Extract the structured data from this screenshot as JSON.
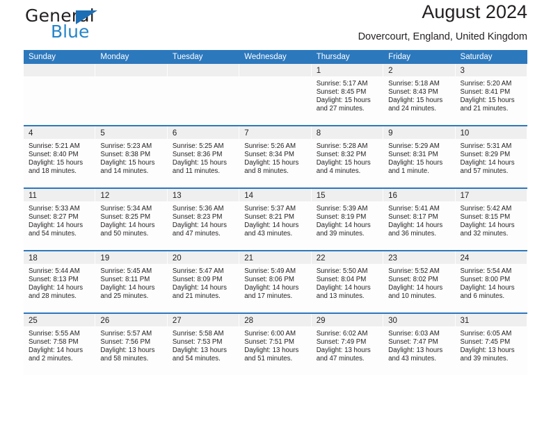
{
  "brand": {
    "name_part1": "General",
    "name_part2": "Blue",
    "triangle_color": "#1c6fb5",
    "blue_text_color": "#2585c9"
  },
  "header": {
    "title": "August 2024",
    "location": "Dovercourt, England, United Kingdom"
  },
  "theme": {
    "header_bar_color": "#2c78bd",
    "daynum_band_color": "#efefef",
    "row_divider_color": "#2c78bd",
    "text_color": "#231f20"
  },
  "weekdays": [
    "Sunday",
    "Monday",
    "Tuesday",
    "Wednesday",
    "Thursday",
    "Friday",
    "Saturday"
  ],
  "weeks": [
    [
      {
        "day": "",
        "sunrise": "",
        "sunset": "",
        "daylight": "",
        "empty": true
      },
      {
        "day": "",
        "sunrise": "",
        "sunset": "",
        "daylight": "",
        "empty": true
      },
      {
        "day": "",
        "sunrise": "",
        "sunset": "",
        "daylight": "",
        "empty": true
      },
      {
        "day": "",
        "sunrise": "",
        "sunset": "",
        "daylight": "",
        "empty": true
      },
      {
        "day": "1",
        "sunrise": "Sunrise: 5:17 AM",
        "sunset": "Sunset: 8:45 PM",
        "daylight": "Daylight: 15 hours and 27 minutes."
      },
      {
        "day": "2",
        "sunrise": "Sunrise: 5:18 AM",
        "sunset": "Sunset: 8:43 PM",
        "daylight": "Daylight: 15 hours and 24 minutes."
      },
      {
        "day": "3",
        "sunrise": "Sunrise: 5:20 AM",
        "sunset": "Sunset: 8:41 PM",
        "daylight": "Daylight: 15 hours and 21 minutes."
      }
    ],
    [
      {
        "day": "4",
        "sunrise": "Sunrise: 5:21 AM",
        "sunset": "Sunset: 8:40 PM",
        "daylight": "Daylight: 15 hours and 18 minutes."
      },
      {
        "day": "5",
        "sunrise": "Sunrise: 5:23 AM",
        "sunset": "Sunset: 8:38 PM",
        "daylight": "Daylight: 15 hours and 14 minutes."
      },
      {
        "day": "6",
        "sunrise": "Sunrise: 5:25 AM",
        "sunset": "Sunset: 8:36 PM",
        "daylight": "Daylight: 15 hours and 11 minutes."
      },
      {
        "day": "7",
        "sunrise": "Sunrise: 5:26 AM",
        "sunset": "Sunset: 8:34 PM",
        "daylight": "Daylight: 15 hours and 8 minutes."
      },
      {
        "day": "8",
        "sunrise": "Sunrise: 5:28 AM",
        "sunset": "Sunset: 8:32 PM",
        "daylight": "Daylight: 15 hours and 4 minutes."
      },
      {
        "day": "9",
        "sunrise": "Sunrise: 5:29 AM",
        "sunset": "Sunset: 8:31 PM",
        "daylight": "Daylight: 15 hours and 1 minute."
      },
      {
        "day": "10",
        "sunrise": "Sunrise: 5:31 AM",
        "sunset": "Sunset: 8:29 PM",
        "daylight": "Daylight: 14 hours and 57 minutes."
      }
    ],
    [
      {
        "day": "11",
        "sunrise": "Sunrise: 5:33 AM",
        "sunset": "Sunset: 8:27 PM",
        "daylight": "Daylight: 14 hours and 54 minutes."
      },
      {
        "day": "12",
        "sunrise": "Sunrise: 5:34 AM",
        "sunset": "Sunset: 8:25 PM",
        "daylight": "Daylight: 14 hours and 50 minutes."
      },
      {
        "day": "13",
        "sunrise": "Sunrise: 5:36 AM",
        "sunset": "Sunset: 8:23 PM",
        "daylight": "Daylight: 14 hours and 47 minutes."
      },
      {
        "day": "14",
        "sunrise": "Sunrise: 5:37 AM",
        "sunset": "Sunset: 8:21 PM",
        "daylight": "Daylight: 14 hours and 43 minutes."
      },
      {
        "day": "15",
        "sunrise": "Sunrise: 5:39 AM",
        "sunset": "Sunset: 8:19 PM",
        "daylight": "Daylight: 14 hours and 39 minutes."
      },
      {
        "day": "16",
        "sunrise": "Sunrise: 5:41 AM",
        "sunset": "Sunset: 8:17 PM",
        "daylight": "Daylight: 14 hours and 36 minutes."
      },
      {
        "day": "17",
        "sunrise": "Sunrise: 5:42 AM",
        "sunset": "Sunset: 8:15 PM",
        "daylight": "Daylight: 14 hours and 32 minutes."
      }
    ],
    [
      {
        "day": "18",
        "sunrise": "Sunrise: 5:44 AM",
        "sunset": "Sunset: 8:13 PM",
        "daylight": "Daylight: 14 hours and 28 minutes."
      },
      {
        "day": "19",
        "sunrise": "Sunrise: 5:45 AM",
        "sunset": "Sunset: 8:11 PM",
        "daylight": "Daylight: 14 hours and 25 minutes."
      },
      {
        "day": "20",
        "sunrise": "Sunrise: 5:47 AM",
        "sunset": "Sunset: 8:09 PM",
        "daylight": "Daylight: 14 hours and 21 minutes."
      },
      {
        "day": "21",
        "sunrise": "Sunrise: 5:49 AM",
        "sunset": "Sunset: 8:06 PM",
        "daylight": "Daylight: 14 hours and 17 minutes."
      },
      {
        "day": "22",
        "sunrise": "Sunrise: 5:50 AM",
        "sunset": "Sunset: 8:04 PM",
        "daylight": "Daylight: 14 hours and 13 minutes."
      },
      {
        "day": "23",
        "sunrise": "Sunrise: 5:52 AM",
        "sunset": "Sunset: 8:02 PM",
        "daylight": "Daylight: 14 hours and 10 minutes."
      },
      {
        "day": "24",
        "sunrise": "Sunrise: 5:54 AM",
        "sunset": "Sunset: 8:00 PM",
        "daylight": "Daylight: 14 hours and 6 minutes."
      }
    ],
    [
      {
        "day": "25",
        "sunrise": "Sunrise: 5:55 AM",
        "sunset": "Sunset: 7:58 PM",
        "daylight": "Daylight: 14 hours and 2 minutes."
      },
      {
        "day": "26",
        "sunrise": "Sunrise: 5:57 AM",
        "sunset": "Sunset: 7:56 PM",
        "daylight": "Daylight: 13 hours and 58 minutes."
      },
      {
        "day": "27",
        "sunrise": "Sunrise: 5:58 AM",
        "sunset": "Sunset: 7:53 PM",
        "daylight": "Daylight: 13 hours and 54 minutes."
      },
      {
        "day": "28",
        "sunrise": "Sunrise: 6:00 AM",
        "sunset": "Sunset: 7:51 PM",
        "daylight": "Daylight: 13 hours and 51 minutes."
      },
      {
        "day": "29",
        "sunrise": "Sunrise: 6:02 AM",
        "sunset": "Sunset: 7:49 PM",
        "daylight": "Daylight: 13 hours and 47 minutes."
      },
      {
        "day": "30",
        "sunrise": "Sunrise: 6:03 AM",
        "sunset": "Sunset: 7:47 PM",
        "daylight": "Daylight: 13 hours and 43 minutes."
      },
      {
        "day": "31",
        "sunrise": "Sunrise: 6:05 AM",
        "sunset": "Sunset: 7:45 PM",
        "daylight": "Daylight: 13 hours and 39 minutes."
      }
    ]
  ]
}
